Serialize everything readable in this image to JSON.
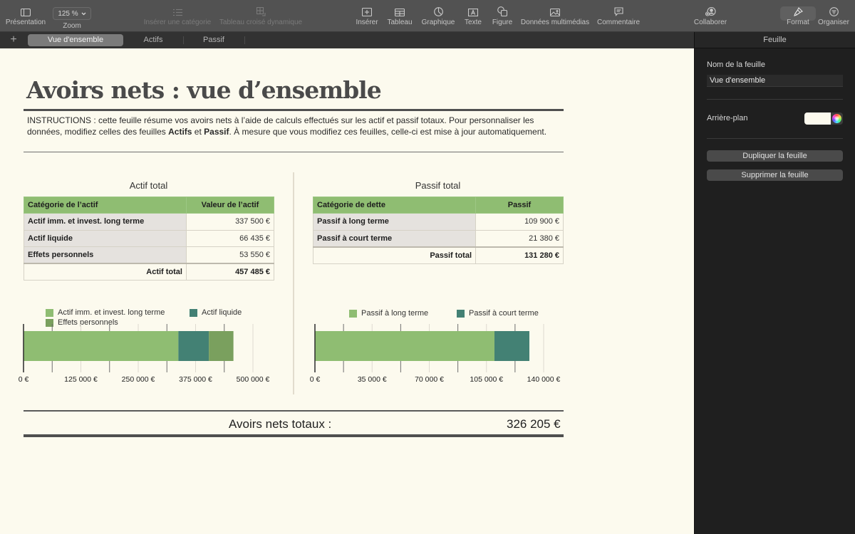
{
  "toolbar": {
    "items": [
      {
        "label": "Présentation",
        "icon": "sidebar-view-icon",
        "enabled": true
      },
      {
        "label": "Zoom",
        "value": "125 %",
        "icon": "chevron-down-icon",
        "enabled": true
      },
      {
        "label": "Insérer une catégorie",
        "icon": "list-icon",
        "enabled": false
      },
      {
        "label": "Tableau croisé dynamique",
        "icon": "pivot-table-icon",
        "enabled": false
      },
      {
        "label": "Insérer",
        "icon": "insert-icon",
        "enabled": true
      },
      {
        "label": "Tableau",
        "icon": "table-icon",
        "enabled": true
      },
      {
        "label": "Graphique",
        "icon": "chart-icon",
        "enabled": true
      },
      {
        "label": "Texte",
        "icon": "text-box-icon",
        "enabled": true
      },
      {
        "label": "Figure",
        "icon": "shape-icon",
        "enabled": true
      },
      {
        "label": "Données multimédias",
        "icon": "media-icon",
        "enabled": true
      },
      {
        "label": "Commentaire",
        "icon": "comment-icon",
        "enabled": true
      },
      {
        "label": "Collaborer",
        "icon": "collaborate-icon",
        "enabled": true
      },
      {
        "label": "Format",
        "icon": "paintbrush-icon",
        "enabled": true,
        "active": true
      },
      {
        "label": "Organiser",
        "icon": "organize-icon",
        "enabled": true
      }
    ]
  },
  "tabs": {
    "add_label": "+",
    "items": [
      {
        "label": "Vue d'ensemble",
        "active": true
      },
      {
        "label": "Actifs",
        "active": false
      },
      {
        "label": "Passif",
        "active": false
      }
    ]
  },
  "sidebar": {
    "header": "Feuille",
    "sheet_name_label": "Nom de la feuille",
    "sheet_name_value": "Vue d'ensemble",
    "background_label": "Arrière-plan",
    "background_color": "#fcfaee",
    "duplicate_button": "Dupliquer la feuille",
    "delete_button": "Supprimer la feuille"
  },
  "page": {
    "title": "Avoirs nets : vue d’ensemble",
    "instructions": {
      "part1": "INSTRUCTIONS : cette feuille résume vos avoirs nets à l’aide de calculs effectués sur les actif et passif totaux. Pour personnaliser les données, modifiez celles des feuilles ",
      "bold1": "Actifs",
      "part2": " et ",
      "bold2": "Passif",
      "part3": ". À mesure que vous modifiez ces feuilles, celle-ci est mise à jour automatiquement."
    },
    "net_worth_label": "Avoirs nets totaux :",
    "net_worth_value": "326 205 €"
  },
  "assets": {
    "section_title": "Actif total",
    "headers": [
      "Catégorie de l’actif",
      "Valeur de l’actif"
    ],
    "rows": [
      {
        "category": "Actif imm. et invest. long terme",
        "value": "337 500 €"
      },
      {
        "category": "Actif liquide",
        "value": "66 435 €"
      },
      {
        "category": "Effets personnels",
        "value": "53 550 €"
      }
    ],
    "total_label": "Actif total",
    "total_value": "457 485 €"
  },
  "liabilities": {
    "section_title": "Passif total",
    "headers": [
      "Catégorie de dette",
      "Passif"
    ],
    "rows": [
      {
        "category": "Passif à long terme",
        "value": "109 900 €"
      },
      {
        "category": "Passif à court terme",
        "value": "21 380 €"
      }
    ],
    "total_label": "Passif total",
    "total_value": "131 280 €"
  },
  "colors": {
    "header_green": "#8fbd72",
    "series_light_green": "#8fbd72",
    "series_teal": "#438174",
    "series_olive": "#7aa05e"
  },
  "chart_data": [
    {
      "type": "bar",
      "orientation": "horizontal-stacked",
      "title": "",
      "categories": [
        ""
      ],
      "series": [
        {
          "name": "Actif imm. et invest. long terme",
          "values": [
            337500
          ],
          "color": "#8fbd72"
        },
        {
          "name": "Actif liquide",
          "values": [
            66435
          ],
          "color": "#438174"
        },
        {
          "name": "Effets personnels",
          "values": [
            53550
          ],
          "color": "#7aa05e"
        }
      ],
      "xlim": [
        0,
        500000
      ],
      "x_ticks": [
        0,
        125000,
        250000,
        375000,
        500000
      ],
      "x_tick_labels": [
        "0 €",
        "125 000 €",
        "250 000 €",
        "375 000 €",
        "500 000 €"
      ],
      "minor_ticks": [
        62500,
        187500,
        312500,
        437500
      ],
      "xlabel": "",
      "ylabel": "",
      "grid": true,
      "legend": "top"
    },
    {
      "type": "bar",
      "orientation": "horizontal-stacked",
      "title": "",
      "categories": [
        ""
      ],
      "series": [
        {
          "name": "Passif à long terme",
          "values": [
            109900
          ],
          "color": "#8fbd72"
        },
        {
          "name": "Passif à court terme",
          "values": [
            21380
          ],
          "color": "#438174"
        }
      ],
      "xlim": [
        0,
        140000
      ],
      "x_ticks": [
        0,
        35000,
        70000,
        105000,
        140000
      ],
      "x_tick_labels": [
        "0 €",
        "35 000 €",
        "70 000 €",
        "105 000 €",
        "140 000 €"
      ],
      "minor_ticks": [
        17500,
        52500,
        87500,
        122500
      ],
      "xlabel": "",
      "ylabel": "",
      "grid": true,
      "legend": "top"
    }
  ]
}
